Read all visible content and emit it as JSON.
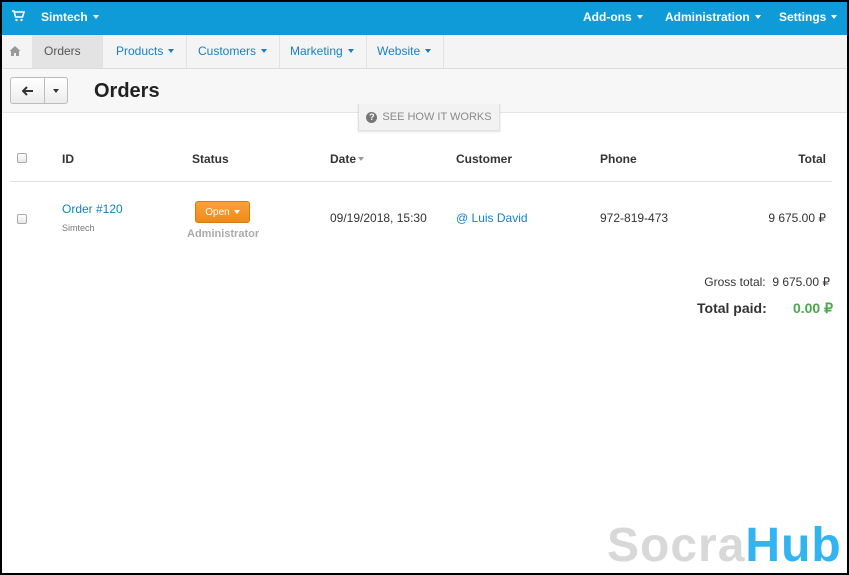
{
  "topbar": {
    "store_name": "Simtech",
    "addons": "Add-ons",
    "administration": "Administration",
    "settings": "Settings"
  },
  "nav": {
    "orders": "Orders",
    "products": "Products",
    "customers": "Customers",
    "marketing": "Marketing",
    "website": "Website"
  },
  "page": {
    "title": "Orders",
    "how_it_works": "SEE HOW IT WORKS"
  },
  "table": {
    "headers": {
      "id": "ID",
      "status": "Status",
      "date": "Date",
      "customer": "Customer",
      "phone": "Phone",
      "total": "Total"
    },
    "rows": [
      {
        "order": "Order #120",
        "company": "Simtech",
        "status": "Open",
        "status_by": "Administrator",
        "date": "09/19/2018, 15:30",
        "customer": "@ Luis David",
        "phone": "972-819-473",
        "total": "9 675.00 ₽"
      }
    ]
  },
  "summary": {
    "gross_label": "Gross total:",
    "gross_value": "9 675.00 ₽",
    "paid_label": "Total paid:",
    "paid_value": "0.00 ₽"
  },
  "watermark": {
    "part1": "Socra",
    "part2": "Hub"
  },
  "colors": {
    "topbar": "#0f9ad8",
    "link": "#1780c3",
    "status_open": "#f08a16",
    "paid": "#4aa84a"
  },
  "icons": [
    "cart-icon",
    "home-icon",
    "arrow-left-icon",
    "question-icon"
  ]
}
